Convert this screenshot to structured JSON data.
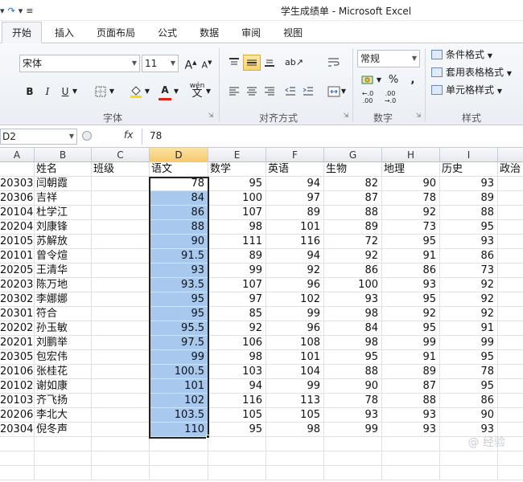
{
  "window": {
    "title": "学生成绩单 - Microsoft Excel",
    "qat_items": [
      "↶",
      "▾",
      "↷",
      "▾",
      "≡"
    ]
  },
  "ribbon_tabs": [
    {
      "label": "开始",
      "active": true
    },
    {
      "label": "插入",
      "active": false
    },
    {
      "label": "页面布局",
      "active": false
    },
    {
      "label": "公式",
      "active": false
    },
    {
      "label": "数据",
      "active": false
    },
    {
      "label": "审阅",
      "active": false
    },
    {
      "label": "视图",
      "active": false
    }
  ],
  "ribbon": {
    "font_name": "宋体",
    "font_size": "11",
    "grow_font": "A",
    "shrink_font": "A",
    "bold": "B",
    "italic": "I",
    "underline": "U",
    "number_format": "常规",
    "percent": "%",
    "comma": ",",
    "inc_decimal": "←.0 .00",
    "dec_decimal": ".00 →.0",
    "conditional_format": "条件格式",
    "format_as_table": "套用表格格式",
    "cell_styles": "单元格样式",
    "groups": {
      "font": "字体",
      "alignment": "对齐方式",
      "number": "数字",
      "styles": "样式"
    }
  },
  "formula_bar": {
    "name_box": "D2",
    "fx_label": "fx",
    "value": "78"
  },
  "sheet": {
    "columns": [
      "A",
      "B",
      "C",
      "D",
      "E",
      "F",
      "G",
      "H",
      "I"
    ],
    "selected_column": "D",
    "header_row": [
      "",
      "姓名",
      "班级",
      "语文",
      "数学",
      "英语",
      "生物",
      "地理",
      "历史",
      "政治"
    ],
    "rows": [
      {
        "id": "20303",
        "name": "闫朝霞",
        "cls": "",
        "yw": "78",
        "sx": "95",
        "yy": "94",
        "sw": "82",
        "dl": "90",
        "ls": "93"
      },
      {
        "id": "20306",
        "name": "吉祥",
        "cls": "",
        "yw": "84",
        "sx": "100",
        "yy": "97",
        "sw": "87",
        "dl": "78",
        "ls": "89"
      },
      {
        "id": "20104",
        "name": "杜学江",
        "cls": "",
        "yw": "86",
        "sx": "107",
        "yy": "89",
        "sw": "88",
        "dl": "92",
        "ls": "88"
      },
      {
        "id": "20204",
        "name": "刘康锋",
        "cls": "",
        "yw": "88",
        "sx": "98",
        "yy": "101",
        "sw": "89",
        "dl": "73",
        "ls": "95"
      },
      {
        "id": "20105",
        "name": "苏解放",
        "cls": "",
        "yw": "90",
        "sx": "111",
        "yy": "116",
        "sw": "72",
        "dl": "95",
        "ls": "93"
      },
      {
        "id": "20101",
        "name": "曾令煊",
        "cls": "",
        "yw": "91.5",
        "sx": "89",
        "yy": "94",
        "sw": "92",
        "dl": "91",
        "ls": "86"
      },
      {
        "id": "20205",
        "name": "王清华",
        "cls": "",
        "yw": "93",
        "sx": "99",
        "yy": "92",
        "sw": "86",
        "dl": "86",
        "ls": "73"
      },
      {
        "id": "20203",
        "name": "陈万地",
        "cls": "",
        "yw": "93.5",
        "sx": "107",
        "yy": "96",
        "sw": "100",
        "dl": "93",
        "ls": "92"
      },
      {
        "id": "20302",
        "name": "李娜娜",
        "cls": "",
        "yw": "95",
        "sx": "97",
        "yy": "102",
        "sw": "93",
        "dl": "95",
        "ls": "92"
      },
      {
        "id": "20301",
        "name": "符合",
        "cls": "",
        "yw": "95",
        "sx": "85",
        "yy": "99",
        "sw": "98",
        "dl": "92",
        "ls": "92"
      },
      {
        "id": "20202",
        "name": "孙玉敏",
        "cls": "",
        "yw": "95.5",
        "sx": "92",
        "yy": "96",
        "sw": "84",
        "dl": "95",
        "ls": "91"
      },
      {
        "id": "20201",
        "name": "刘鹏举",
        "cls": "",
        "yw": "97.5",
        "sx": "106",
        "yy": "108",
        "sw": "98",
        "dl": "99",
        "ls": "99"
      },
      {
        "id": "20305",
        "name": "包宏伟",
        "cls": "",
        "yw": "99",
        "sx": "98",
        "yy": "101",
        "sw": "95",
        "dl": "91",
        "ls": "95"
      },
      {
        "id": "20106",
        "name": "张桂花",
        "cls": "",
        "yw": "100.5",
        "sx": "103",
        "yy": "104",
        "sw": "88",
        "dl": "89",
        "ls": "78"
      },
      {
        "id": "20102",
        "name": "谢如康",
        "cls": "",
        "yw": "101",
        "sx": "94",
        "yy": "99",
        "sw": "90",
        "dl": "87",
        "ls": "95"
      },
      {
        "id": "20103",
        "name": "齐飞扬",
        "cls": "",
        "yw": "102",
        "sx": "116",
        "yy": "113",
        "sw": "78",
        "dl": "88",
        "ls": "86"
      },
      {
        "id": "20206",
        "name": "李北大",
        "cls": "",
        "yw": "103.5",
        "sx": "105",
        "yy": "105",
        "sw": "93",
        "dl": "93",
        "ls": "90"
      },
      {
        "id": "20304",
        "name": "倪冬声",
        "cls": "",
        "yw": "110",
        "sx": "95",
        "yy": "98",
        "sw": "99",
        "dl": "93",
        "ls": "93"
      }
    ]
  },
  "colors": {
    "selection_fill": "#a9c8ee",
    "selected_header": "#f6c86a",
    "ribbon_bg": "#eaeef4"
  },
  "watermark": "@ 经验"
}
